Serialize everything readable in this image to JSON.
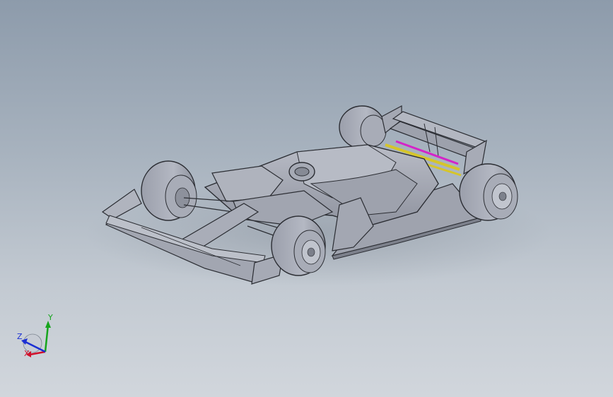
{
  "viewport": {
    "background_top": "#8d9bab",
    "background_bottom": "#d1d6dc",
    "model_name": "formula-car-model"
  },
  "triad": {
    "x_label": "X",
    "y_label": "Y",
    "z_label": "Z",
    "x_color": "#d0102a",
    "y_color": "#16a51d",
    "z_color": "#1b2fd3"
  },
  "accents": {
    "yellow": "#d6c52a",
    "magenta": "#d424c8"
  }
}
